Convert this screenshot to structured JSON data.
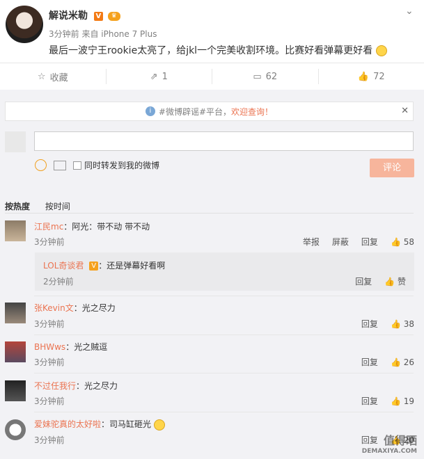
{
  "post": {
    "author": "解说米勒",
    "vip_mark": "V",
    "time": "3分钟前",
    "source": "来自 iPhone 7 Plus",
    "text": "最后一波宁王rookie太亮了，给jkl一个完美收割环境。比赛好看弹幕更好看"
  },
  "actions": {
    "favorite": "收藏",
    "repost_count": "1",
    "comment_count": "62",
    "like_count": "72"
  },
  "notice": {
    "prefix": "#微博辟谣#平台，",
    "link": "欢迎查询！"
  },
  "composer": {
    "repost_option": "同时转发到我的微博",
    "submit": "评论"
  },
  "sort": {
    "hot": "按热度",
    "time": "按时间"
  },
  "labels": {
    "report": "举报",
    "hide": "屏蔽",
    "reply": "回复",
    "like": "赞"
  },
  "comments": [
    {
      "user": "江民mc",
      "text": "：阿光：带不动 带不动",
      "time": "3分钟前",
      "likes": "58"
    },
    {
      "user": "LOL奇谈君",
      "text": "：还是弹幕好看啊",
      "time": "2分钟前"
    },
    {
      "user": "张Kevin文",
      "text": "：光之尽力",
      "time": "3分钟前",
      "likes": "38"
    },
    {
      "user": "BHWws",
      "text": "：光之贼逗",
      "time": "3分钟前",
      "likes": "26"
    },
    {
      "user": "不过任我行",
      "text": "：光之尽力",
      "time": "3分钟前",
      "likes": "19"
    },
    {
      "user": "爱妹驼真的太好啦",
      "text": "：司马缸砸光",
      "time": "3分钟前",
      "likes": "20"
    }
  ],
  "watermark": {
    "main": "值得晒",
    "sub": "DEMAXIYA.COM"
  },
  "colors": {
    "link": "#eb7350",
    "button": "#f7b59c",
    "background": "#f2f2f5"
  }
}
